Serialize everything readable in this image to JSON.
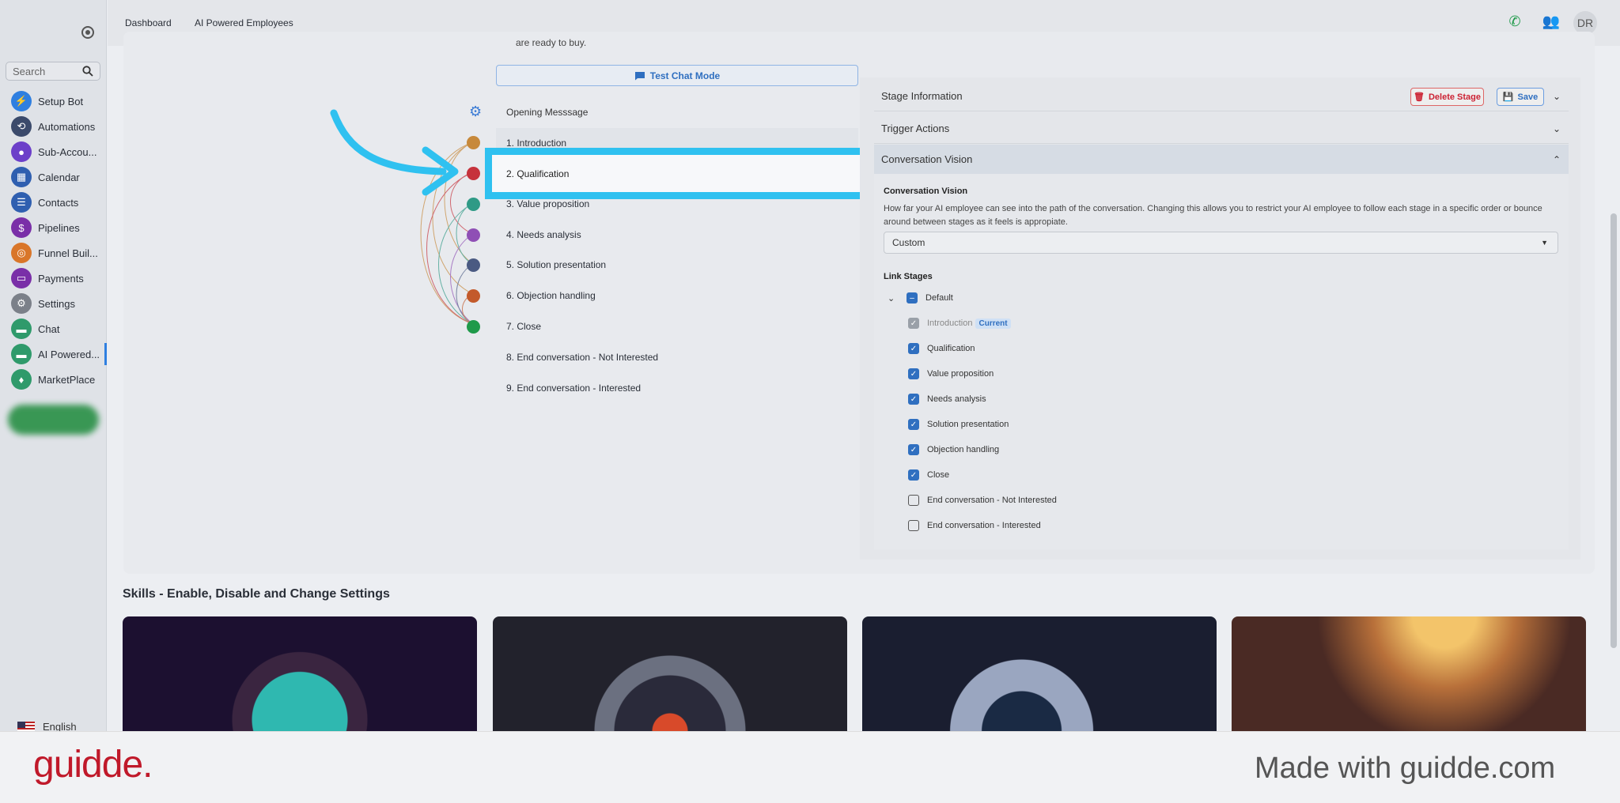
{
  "sidebar": {
    "search_placeholder": "Search",
    "items": [
      {
        "label": "Setup Bot",
        "icon": "bolt-icon",
        "color": "#2f7fe0"
      },
      {
        "label": "Automations",
        "icon": "automation-icon",
        "color": "#3b4a6b"
      },
      {
        "label": "Sub-Accou...",
        "icon": "user-icon",
        "color": "#6c3fc9"
      },
      {
        "label": "Calendar",
        "icon": "calendar-icon",
        "color": "#2f5fb0"
      },
      {
        "label": "Contacts",
        "icon": "contacts-icon",
        "color": "#2f5fb0"
      },
      {
        "label": "Pipelines",
        "icon": "pipeline-icon",
        "color": "#7a2fa8"
      },
      {
        "label": "Funnel Buil...",
        "icon": "funnel-icon",
        "color": "#d9762a"
      },
      {
        "label": "Payments",
        "icon": "card-icon",
        "color": "#7a2fa8"
      },
      {
        "label": "Settings",
        "icon": "gear-icon",
        "color": "#7b8089"
      },
      {
        "label": "Chat",
        "icon": "chat-icon",
        "color": "#2f9a6b"
      },
      {
        "label": "AI Powered...",
        "icon": "ai-chat-icon",
        "color": "#2f9a6b"
      },
      {
        "label": "MarketPlace",
        "icon": "bulb-icon",
        "color": "#2f9a6b"
      }
    ],
    "language": "English"
  },
  "topbar": {
    "tabs": [
      "Dashboard",
      "AI Powered Employees"
    ],
    "user_initials": "DR"
  },
  "main": {
    "ready_text": "are ready to buy.",
    "test_chat_label": "Test Chat Mode",
    "opening_label": "Opening Messsage",
    "stages": [
      "1. Introduction",
      "2. Qualification",
      "3. Value proposition",
      "4. Needs analysis",
      "5. Solution presentation",
      "6. Objection handling",
      "7. Close",
      "8. End conversation - Not Interested",
      "9. End conversation - Interested"
    ],
    "stage_colors": [
      "#c7893b",
      "#c6323c",
      "#2f9a86",
      "#8f4fb5",
      "#4a5a82",
      "#c35a2b",
      "#1f9a4a"
    ]
  },
  "panel": {
    "stage_info": "Stage Information",
    "delete_label": "Delete Stage",
    "save_label": "Save",
    "trigger_actions": "Trigger Actions",
    "conversation_vision": "Conversation Vision",
    "cv_title": "Conversation Vision",
    "cv_desc": "How far your AI employee can see into the path of the conversation. Changing this allows you to restrict your AI employee to follow each stage in a specific order or bounce around between stages as it feels is appropiate.",
    "cv_value": "Custom",
    "link_title": "Link Stages",
    "default_label": "Default",
    "current_badge": "Current",
    "links": [
      {
        "label": "Introduction",
        "state": "disabled"
      },
      {
        "label": "Qualification",
        "state": "on"
      },
      {
        "label": "Value proposition",
        "state": "on"
      },
      {
        "label": "Needs analysis",
        "state": "on"
      },
      {
        "label": "Solution presentation",
        "state": "on"
      },
      {
        "label": "Objection handling",
        "state": "on"
      },
      {
        "label": "Close",
        "state": "on"
      },
      {
        "label": "End conversation - Not Interested",
        "state": "off"
      },
      {
        "label": "End conversation - Interested",
        "state": "off"
      }
    ]
  },
  "skills_title": "Skills - Enable, Disable and Change Settings",
  "footer": {
    "logo": "guidde.",
    "made_with": "Made with guidde.com"
  }
}
